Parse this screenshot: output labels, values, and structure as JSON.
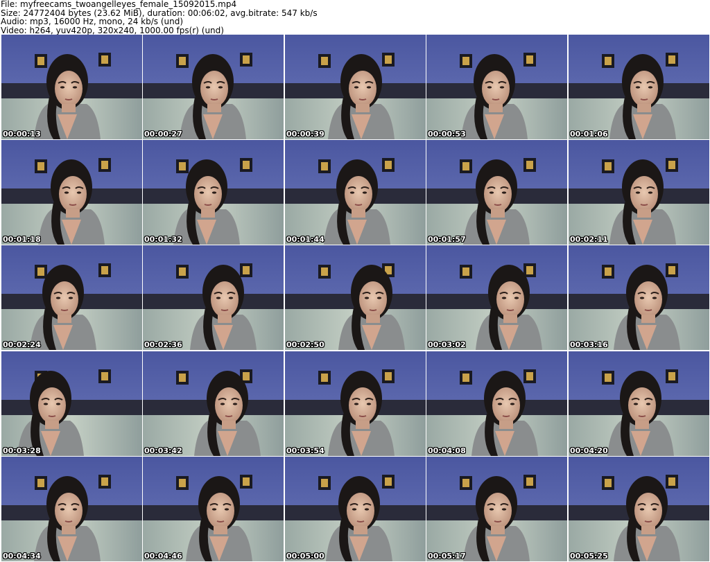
{
  "header": {
    "file_line": "File: myfreecams_twoangelleyes_female_15092015.mp4",
    "size_line": "Size: 24772404 bytes (23.62 MiB), duration: 00:06:02, avg.bitrate: 547 kb/s",
    "audio_line": "Audio: mp3, 16000 Hz, mono, 24 kb/s (und)",
    "video_line": "Video: h264, yuv420p, 320x240, 1000.00 fps(r) (und)"
  },
  "thumbnails": [
    {
      "timestamp": "00:00:13"
    },
    {
      "timestamp": "00:00:27"
    },
    {
      "timestamp": "00:00:39"
    },
    {
      "timestamp": "00:00:53"
    },
    {
      "timestamp": "00:01:06"
    },
    {
      "timestamp": "00:01:18"
    },
    {
      "timestamp": "00:01:32"
    },
    {
      "timestamp": "00:01:44"
    },
    {
      "timestamp": "00:01:57"
    },
    {
      "timestamp": "00:02:11"
    },
    {
      "timestamp": "00:02:24"
    },
    {
      "timestamp": "00:02:36"
    },
    {
      "timestamp": "00:02:50"
    },
    {
      "timestamp": "00:03:02"
    },
    {
      "timestamp": "00:03:16"
    },
    {
      "timestamp": "00:03:28"
    },
    {
      "timestamp": "00:03:42"
    },
    {
      "timestamp": "00:03:54"
    },
    {
      "timestamp": "00:04:08"
    },
    {
      "timestamp": "00:04:20"
    },
    {
      "timestamp": "00:04:34"
    },
    {
      "timestamp": "00:04:46"
    },
    {
      "timestamp": "00:05:00"
    },
    {
      "timestamp": "00:05:17"
    },
    {
      "timestamp": "00:05:25"
    }
  ]
}
